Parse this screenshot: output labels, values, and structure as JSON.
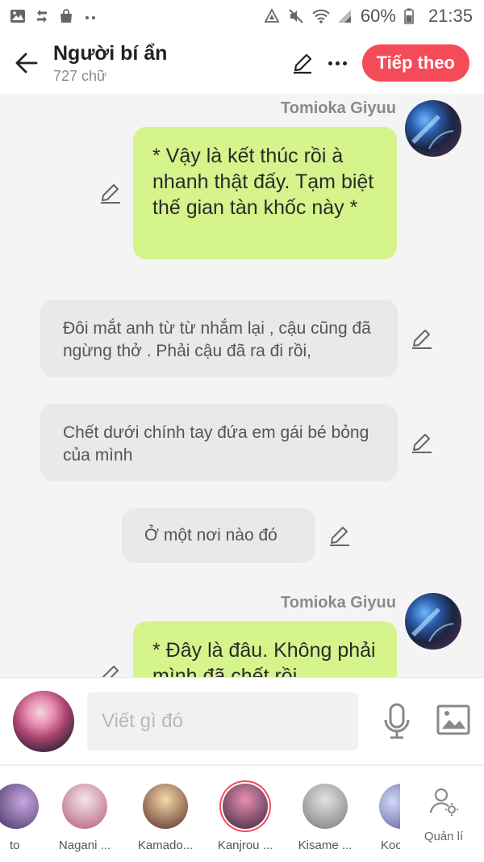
{
  "status_bar": {
    "battery": "60%",
    "time": "21:35"
  },
  "header": {
    "title": "Người bí ẩn",
    "subtitle": "727 chữ",
    "next_button": "Tiếp theo"
  },
  "messages": [
    {
      "type": "character",
      "sender": "Tomioka Giyuu",
      "text": "* Vậy là kết thúc rồi à nhanh thật đấy. Tạm biệt thế gian tàn khốc này *"
    },
    {
      "type": "narration",
      "text": "Đôi mắt anh từ từ nhắm lại , cậu cũng đã ngừng thở . Phải cậu đã ra đi rồi,"
    },
    {
      "type": "narration",
      "text": "Chết dưới chính tay đứa em gái bé bỏng của mình"
    },
    {
      "type": "narration",
      "text": "Ở một nơi nào đó"
    },
    {
      "type": "character",
      "sender": "Tomioka Giyuu",
      "text": "* Đây là đâu. Không phải mình đã chết rồi"
    }
  ],
  "input": {
    "placeholder": "Viết gì đó"
  },
  "characters": [
    {
      "name": "to",
      "color_a": "#c9a7e0",
      "color_b": "#3a2a5a"
    },
    {
      "name": "Nagani ...",
      "color_a": "#f4e6ec",
      "color_b": "#b35a7a"
    },
    {
      "name": "Kamado...",
      "color_a": "#f6d9a8",
      "color_b": "#5a2f2a"
    },
    {
      "name": "Kanjrou ...",
      "color_a": "#e88fb0",
      "color_b": "#3a2540"
    },
    {
      "name": "Kisame ...",
      "color_a": "#e2e2e2",
      "color_b": "#7a7a7a"
    },
    {
      "name": "Koc",
      "color_a": "#d0d8f8",
      "color_b": "#4a4a8a"
    }
  ],
  "manage_label": "Quản lí",
  "colors": {
    "accent": "#f54b59",
    "character_bubble": "#d6f48c",
    "narration_bubble": "#e9e9e9"
  }
}
